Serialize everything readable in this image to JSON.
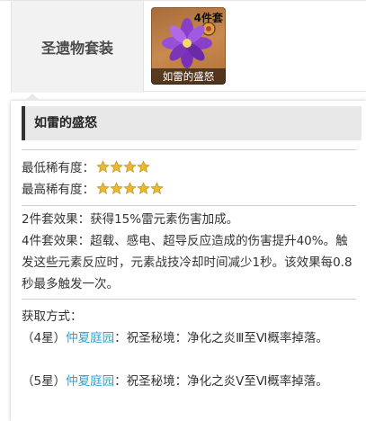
{
  "table": {
    "label": "圣遗物套装",
    "artifact": {
      "count_badge": "4件套",
      "name": "如雷的盛怒"
    }
  },
  "panel": {
    "title": "如雷的盛怒",
    "rarity": {
      "min_label": "最低稀有度：",
      "min_stars": 4,
      "max_label": "最高稀有度：",
      "max_stars": 5
    },
    "effects": {
      "two_piece": "2件套效果：获得15%雷元素伤害加成。",
      "four_piece": "4件套效果：超载、感电、超导反应造成的伤害提升40%。触发这些元素反应时，元素战技冷却时间减少1秒。该效果每0.8秒最多触发一次。"
    },
    "obtain": {
      "label": "获取方式：",
      "items": [
        {
          "prefix": "（4星）",
          "link": "仲夏庭园",
          "text": "：祝圣秘境：净化之炎Ⅲ至Ⅵ概率掉落。"
        },
        {
          "prefix": "（5星）",
          "link": "仲夏庭园",
          "text": "：祝圣秘境：净化之炎Ⅴ至Ⅵ概率掉落。"
        }
      ]
    }
  },
  "colors": {
    "star": "#e8b830",
    "link": "#2e9fd8",
    "title_bar": "#e8e8e8"
  }
}
